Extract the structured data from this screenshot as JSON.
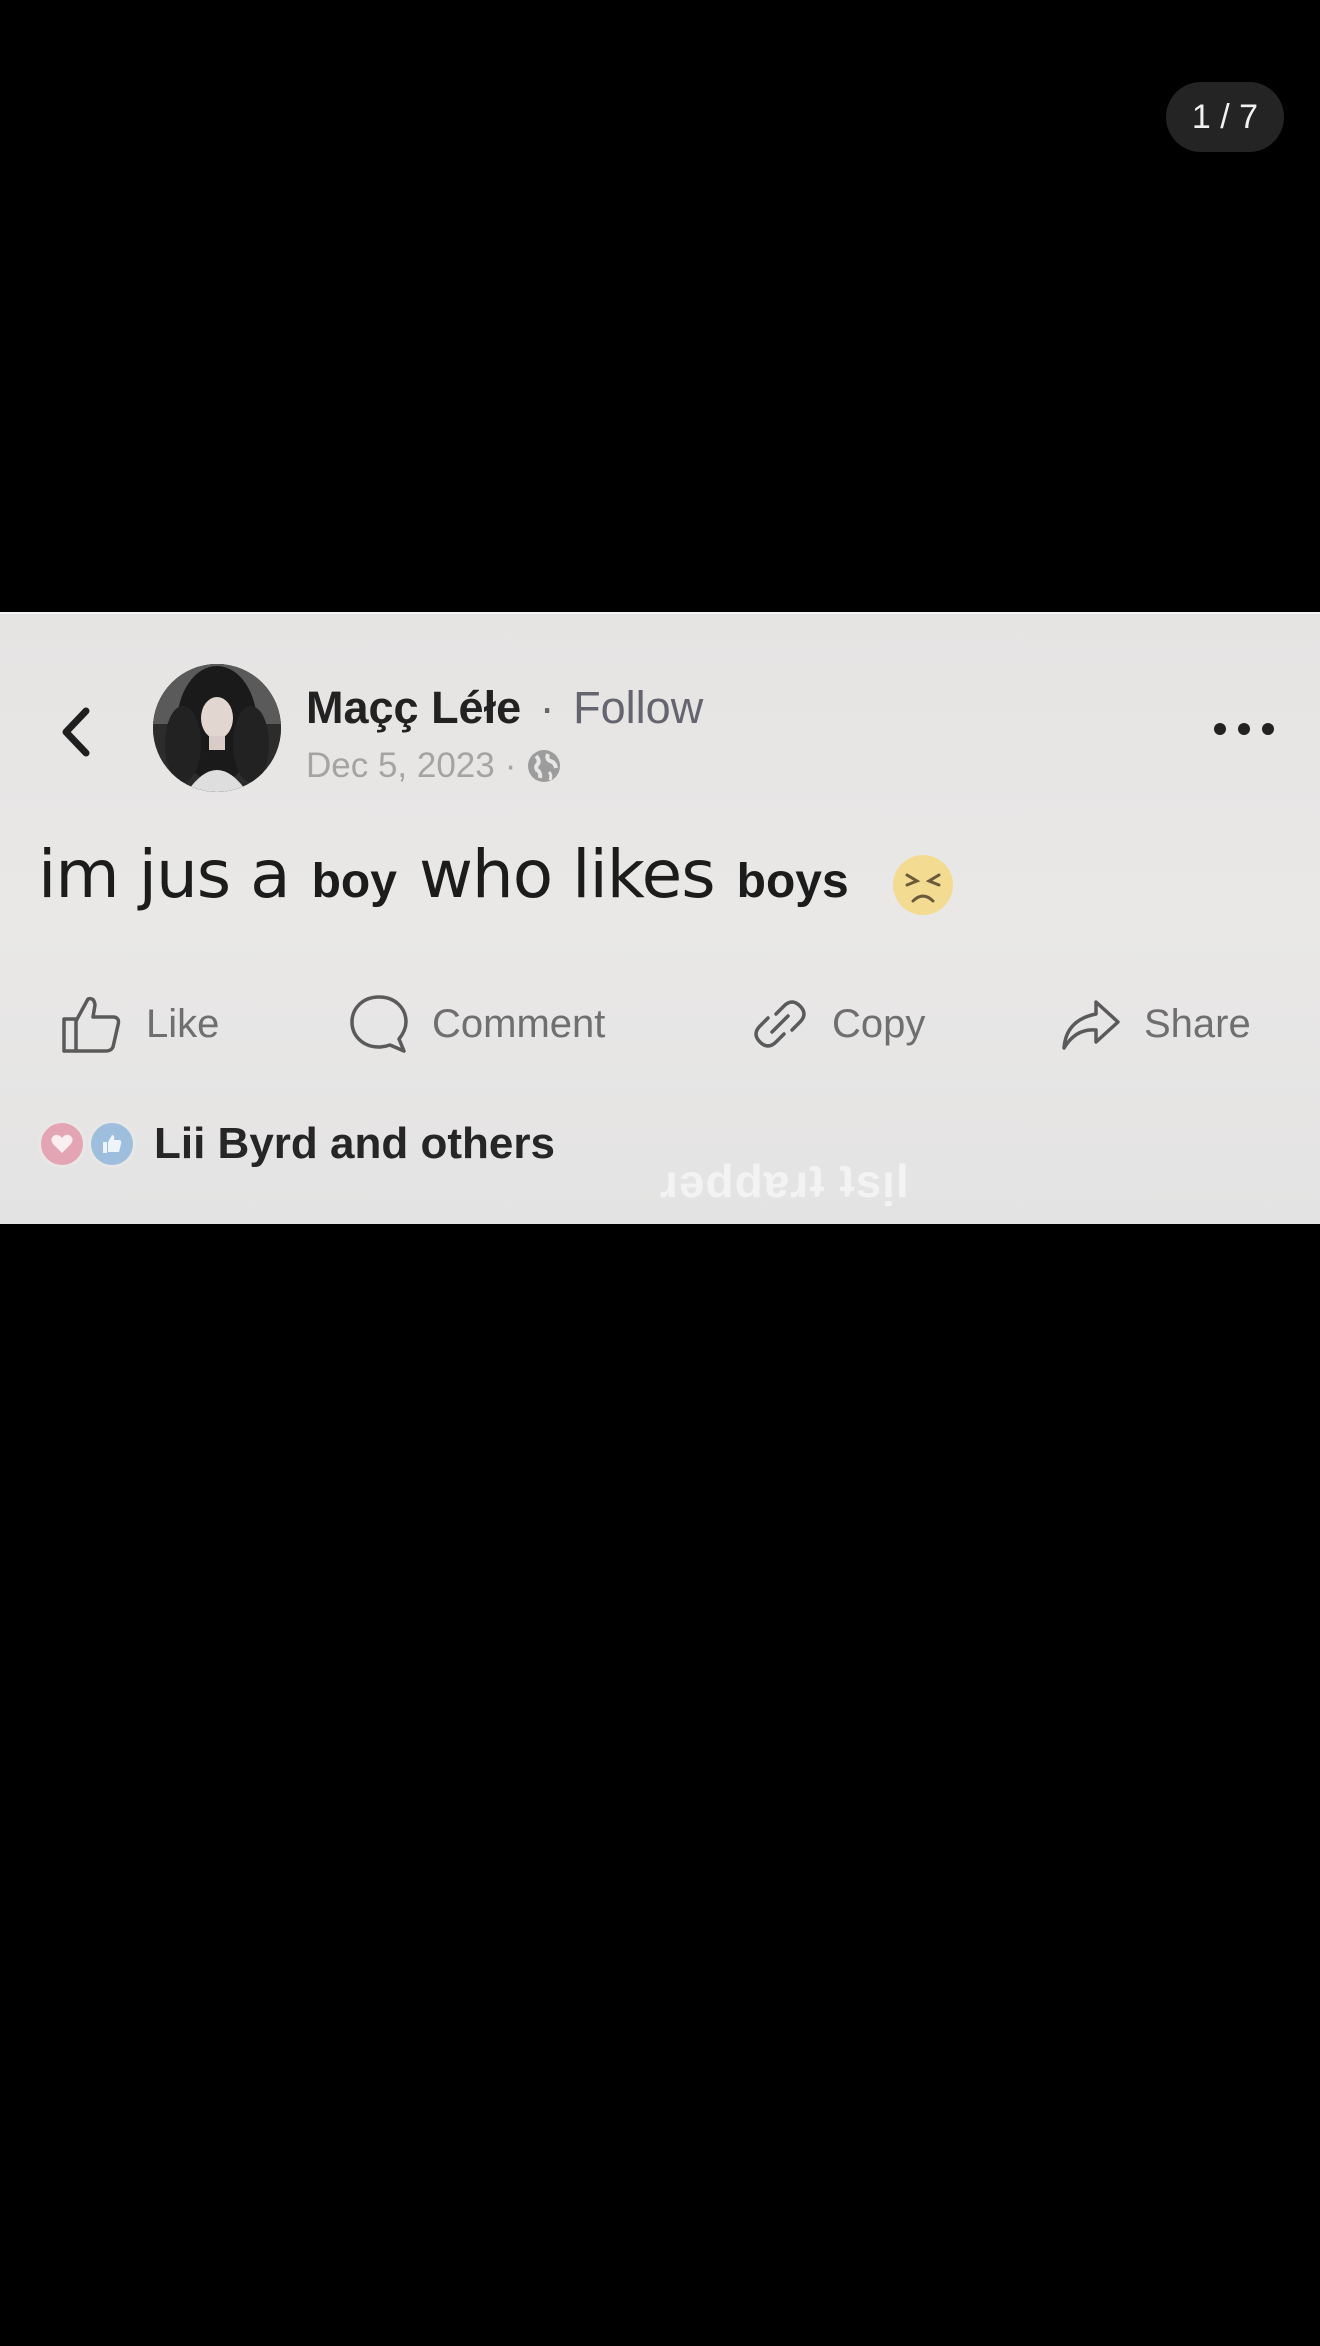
{
  "viewer": {
    "page_counter": "1 / 7"
  },
  "post": {
    "author": "Maçç Léłe",
    "separator": "·",
    "follow_label": "Follow",
    "date": "Dec 5, 2023",
    "audience_icon": "globe-icon",
    "text_parts": {
      "p1": "im jus a",
      "p2": "boy",
      "p3": "who likes",
      "p4": "boys"
    },
    "emoji": "tired-face-emoji",
    "actions": {
      "like": "Like",
      "comment": "Comment",
      "copy": "Copy",
      "share": "Share"
    },
    "reactions_text": "Lii Byrd and others",
    "watermark": "ɹǝddɐɹʇ ʇsᴉl"
  },
  "colors": {
    "background": "#000000",
    "card": "#e8e7e6",
    "text_dark": "#1e1e1e",
    "text_muted": "#6f6f6f",
    "love_reaction": "#e3a5b3",
    "like_reaction": "#9dbfdd"
  }
}
